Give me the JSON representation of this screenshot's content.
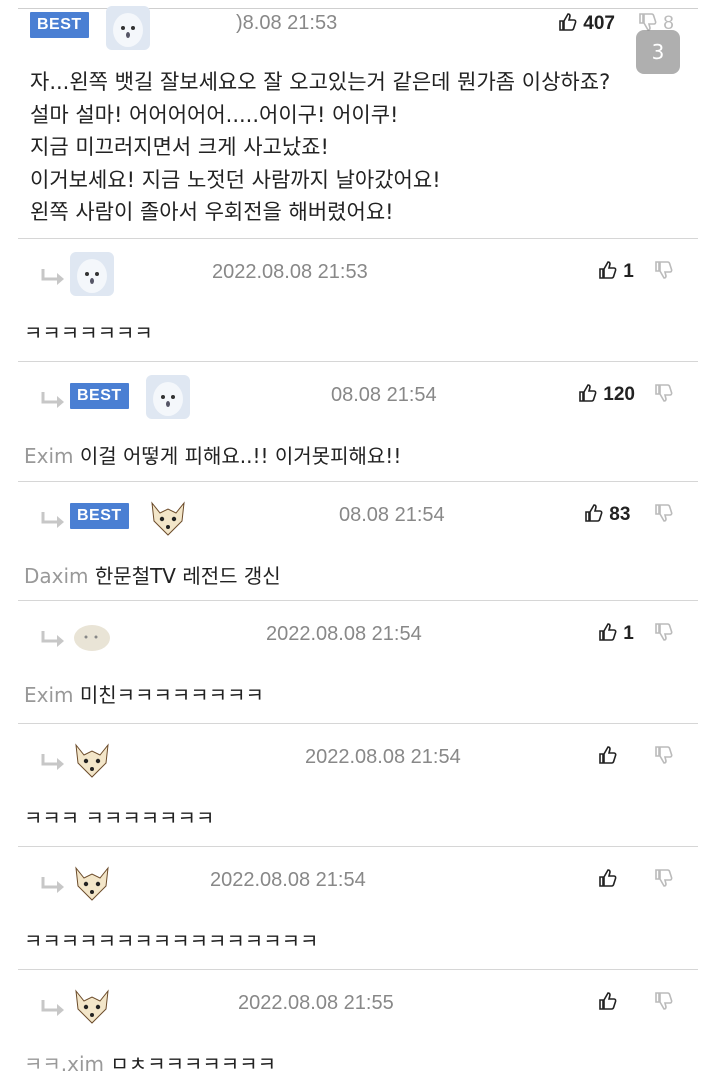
{
  "page_indicator": "3",
  "main_comment": {
    "badge": "BEST",
    "time": ")8.08 21:53",
    "likes": "407",
    "dislikes": "8",
    "lines": "자...왼쪽 뱃길 잘보세요오 잘 오고있는거 같은데 뭔가좀 이상하죠?\n설마 설마! 어어어어어.....어이구! 어이쿠!\n지금 미끄러지면서 크게 사고났죠!\n이거보세요! 지금 노젓던 사람까지 날아갔어요!\n왼쪽 사람이 졸아서 우회전을 해버렸어요!"
  },
  "replies": [
    {
      "badge": "",
      "time": "2022.08.08 21:53",
      "likes": "1",
      "mention": "",
      "text": "ㅋㅋㅋㅋㅋㅋㅋ"
    },
    {
      "badge": "BEST",
      "time": "08.08 21:54",
      "likes": "120",
      "mention": "Exim",
      "text": "이걸 어떻게 피해요..!! 이거못피해요!!"
    },
    {
      "badge": "BEST",
      "time": "08.08 21:54",
      "likes": "83",
      "mention": "Daxim",
      "text": "한문철TV 레전드 갱신"
    },
    {
      "badge": "",
      "time": "2022.08.08 21:54",
      "likes": "1",
      "mention": "Exim",
      "text": "미친ㅋㅋㅋㅋㅋㅋㅋㅋ"
    },
    {
      "badge": "",
      "time": "2022.08.08 21:54",
      "likes": "",
      "mention": "",
      "text": "ㅋㅋㅋ ㅋㅋㅋㅋㅋㅋㅋ"
    },
    {
      "badge": "",
      "time": "2022.08.08 21:54",
      "likes": "",
      "mention": "",
      "text": "ㅋㅋㅋㅋㅋㅋㅋㅋㅋㅋㅋㅋㅋㅋㅋㅋ"
    },
    {
      "badge": "",
      "time": "2022.08.08 21:55",
      "likes": "",
      "mention": "ㅋㅋ.xim",
      "text": "ㅁㅊㅋㅋㅋㅋㅋㅋㅋ"
    }
  ],
  "colors": {
    "best_badge": "#4a7fd3",
    "divider": "#d6d6d6",
    "time": "#888888"
  },
  "icons": {
    "like": "thumbs-up-icon",
    "dislike": "thumbs-down-icon",
    "reply": "reply-arrow-icon"
  }
}
